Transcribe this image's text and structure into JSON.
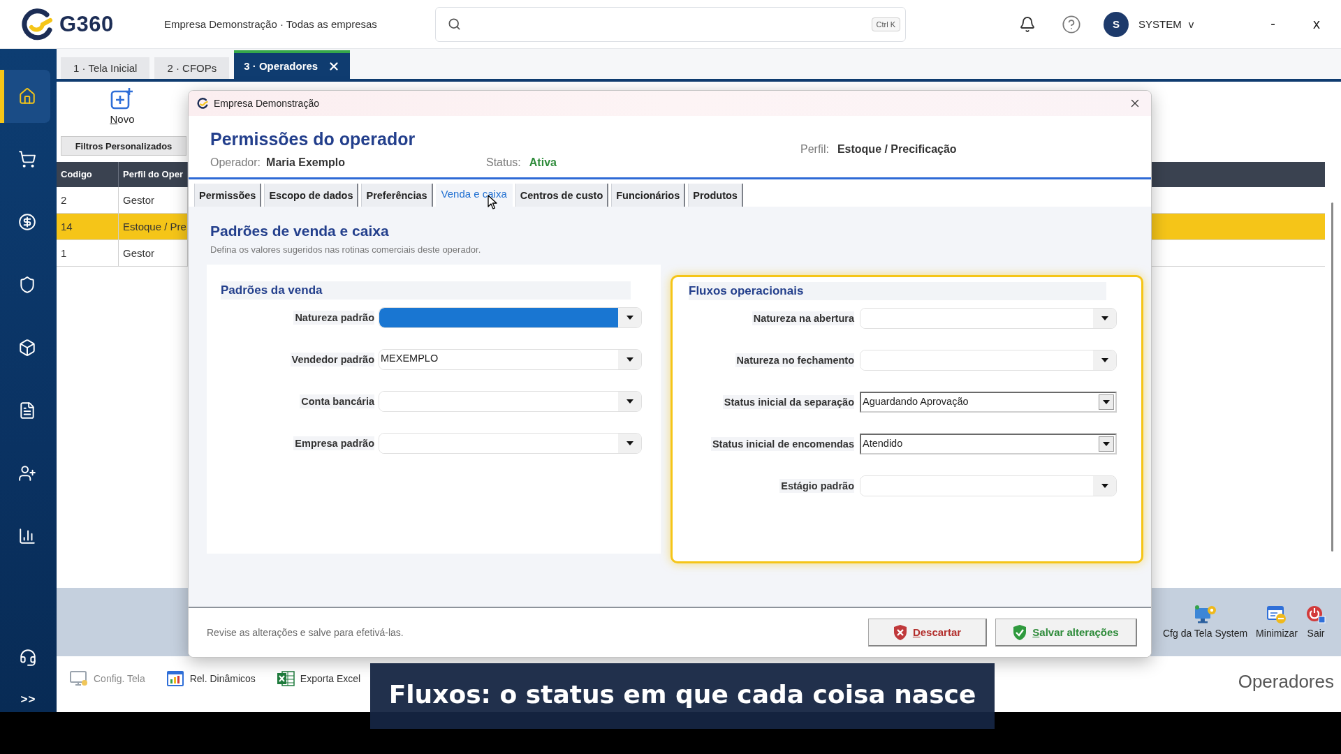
{
  "top_bar": {
    "logo": "G360",
    "company": "Empresa Demonstração · Todas as empresas",
    "search": {
      "shortcut": "Ctrl K"
    },
    "user": {
      "initial": "S",
      "name": "SYSTEM",
      "caret": "v"
    },
    "window_controls": [
      "-",
      "x"
    ]
  },
  "sidebar": {
    "items": [
      {
        "selected": true
      },
      {
        "selected": false
      },
      {
        "selected": false
      },
      {
        "selected": false
      },
      {
        "selected": false
      },
      {
        "selected": false
      },
      {
        "selected": false
      },
      {
        "selected": false
      }
    ],
    "expand": ">>"
  },
  "tabs": [
    {
      "label": "1 · Tela Inicial",
      "selected": false
    },
    {
      "label": "2 · CFOPs",
      "selected": false
    },
    {
      "label": "3 · Operadores",
      "selected": true
    }
  ],
  "toolbar": {
    "new_button": "Novo",
    "filter_button": "Filtros Personalizados"
  },
  "table": {
    "columns": [
      "Codigo",
      "Perfil do Oper"
    ],
    "rows": [
      {
        "cells": [
          "2",
          "Gestor"
        ],
        "selected": false
      },
      {
        "cells": [
          "14",
          "Estoque / Pre"
        ],
        "selected": true
      },
      {
        "cells": [
          "1",
          "Gestor"
        ],
        "selected": false
      }
    ]
  },
  "bottom_bar": {
    "actions": [
      "Cfg da Tela System",
      "Minimizar",
      "Sair"
    ],
    "tools": [
      {
        "label": "Config. Tela",
        "disabled": true
      },
      {
        "label": "Rel. Dinâmicos",
        "disabled": false
      },
      {
        "label": "Exporta Excel",
        "disabled": false
      }
    ],
    "screen_title": "Operadores"
  },
  "dialog": {
    "title": "Empresa Demonstração",
    "heading": "Permissões do operador",
    "operator": {
      "label": "Operador:",
      "value": "Maria Exemplo"
    },
    "status": {
      "label": "Status:",
      "value": "Ativa"
    },
    "profile": {
      "label": "Perfil:",
      "value": "Estoque / Precificação"
    },
    "tabs": [
      {
        "label": "Permissões",
        "selected": false
      },
      {
        "label": "Escopo de dados",
        "selected": false
      },
      {
        "label": "Preferências",
        "selected": false
      },
      {
        "label": "Venda e caixa",
        "selected": true
      },
      {
        "label": "Centros de custo",
        "selected": false
      },
      {
        "label": "Funcionários",
        "selected": false
      },
      {
        "label": "Produtos",
        "selected": false
      }
    ],
    "section": {
      "title": "Padrões de venda e caixa",
      "description": "Defina os valores sugeridos nas rotinas comerciais deste operador."
    },
    "panels": [
      {
        "title": "Padrões da venda",
        "highlighted": false,
        "fields": [
          {
            "label": "Natureza padrão",
            "kind": "flat",
            "focused": true
          },
          {
            "label": "Vendedor padrão",
            "kind": "flat",
            "value": "MEXEMPLO",
            "focused": false
          },
          {
            "label": "Conta bancária",
            "kind": "flat",
            "focused": false
          },
          {
            "label": "Empresa padrão",
            "kind": "flat",
            "focused": false
          }
        ]
      },
      {
        "title": "Fluxos operacionais",
        "highlighted": true,
        "fields": [
          {
            "label": "Natureza na abertura",
            "kind": "flat",
            "focused": false
          },
          {
            "label": "Natureza no fechamento",
            "kind": "flat",
            "focused": false
          },
          {
            "label": "Status inicial da separação",
            "kind": "classic",
            "value": "Aguardando Aprovação",
            "focused": false
          },
          {
            "label": "Status inicial de encomendas",
            "kind": "classic",
            "value": "Atendido",
            "focused": false
          },
          {
            "label": "Estágio padrão",
            "kind": "flat",
            "focused": false
          }
        ]
      }
    ],
    "hint": "Revise as alterações e salve para efetivá-las.",
    "buttons": [
      {
        "label": "Descartar",
        "kind": "discard"
      },
      {
        "label": "Salvar alterações",
        "kind": "save"
      }
    ]
  },
  "caption": "Fluxos: o status em que cada coisa nasce"
}
